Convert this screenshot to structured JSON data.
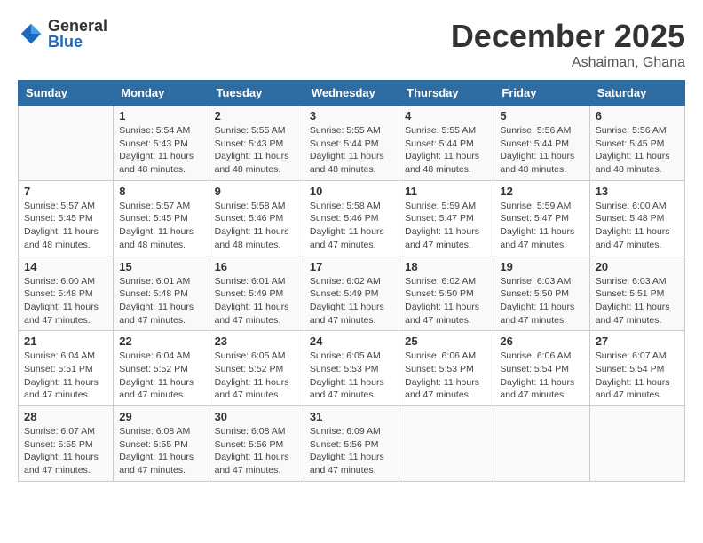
{
  "logo": {
    "general": "General",
    "blue": "Blue"
  },
  "title": "December 2025",
  "location": "Ashaiman, Ghana",
  "days_of_week": [
    "Sunday",
    "Monday",
    "Tuesday",
    "Wednesday",
    "Thursday",
    "Friday",
    "Saturday"
  ],
  "weeks": [
    [
      {
        "day": "",
        "info": ""
      },
      {
        "day": "1",
        "info": "Sunrise: 5:54 AM\nSunset: 5:43 PM\nDaylight: 11 hours\nand 48 minutes."
      },
      {
        "day": "2",
        "info": "Sunrise: 5:55 AM\nSunset: 5:43 PM\nDaylight: 11 hours\nand 48 minutes."
      },
      {
        "day": "3",
        "info": "Sunrise: 5:55 AM\nSunset: 5:44 PM\nDaylight: 11 hours\nand 48 minutes."
      },
      {
        "day": "4",
        "info": "Sunrise: 5:55 AM\nSunset: 5:44 PM\nDaylight: 11 hours\nand 48 minutes."
      },
      {
        "day": "5",
        "info": "Sunrise: 5:56 AM\nSunset: 5:44 PM\nDaylight: 11 hours\nand 48 minutes."
      },
      {
        "day": "6",
        "info": "Sunrise: 5:56 AM\nSunset: 5:45 PM\nDaylight: 11 hours\nand 48 minutes."
      }
    ],
    [
      {
        "day": "7",
        "info": "Sunrise: 5:57 AM\nSunset: 5:45 PM\nDaylight: 11 hours\nand 48 minutes."
      },
      {
        "day": "8",
        "info": "Sunrise: 5:57 AM\nSunset: 5:45 PM\nDaylight: 11 hours\nand 48 minutes."
      },
      {
        "day": "9",
        "info": "Sunrise: 5:58 AM\nSunset: 5:46 PM\nDaylight: 11 hours\nand 48 minutes."
      },
      {
        "day": "10",
        "info": "Sunrise: 5:58 AM\nSunset: 5:46 PM\nDaylight: 11 hours\nand 47 minutes."
      },
      {
        "day": "11",
        "info": "Sunrise: 5:59 AM\nSunset: 5:47 PM\nDaylight: 11 hours\nand 47 minutes."
      },
      {
        "day": "12",
        "info": "Sunrise: 5:59 AM\nSunset: 5:47 PM\nDaylight: 11 hours\nand 47 minutes."
      },
      {
        "day": "13",
        "info": "Sunrise: 6:00 AM\nSunset: 5:48 PM\nDaylight: 11 hours\nand 47 minutes."
      }
    ],
    [
      {
        "day": "14",
        "info": "Sunrise: 6:00 AM\nSunset: 5:48 PM\nDaylight: 11 hours\nand 47 minutes."
      },
      {
        "day": "15",
        "info": "Sunrise: 6:01 AM\nSunset: 5:48 PM\nDaylight: 11 hours\nand 47 minutes."
      },
      {
        "day": "16",
        "info": "Sunrise: 6:01 AM\nSunset: 5:49 PM\nDaylight: 11 hours\nand 47 minutes."
      },
      {
        "day": "17",
        "info": "Sunrise: 6:02 AM\nSunset: 5:49 PM\nDaylight: 11 hours\nand 47 minutes."
      },
      {
        "day": "18",
        "info": "Sunrise: 6:02 AM\nSunset: 5:50 PM\nDaylight: 11 hours\nand 47 minutes."
      },
      {
        "day": "19",
        "info": "Sunrise: 6:03 AM\nSunset: 5:50 PM\nDaylight: 11 hours\nand 47 minutes."
      },
      {
        "day": "20",
        "info": "Sunrise: 6:03 AM\nSunset: 5:51 PM\nDaylight: 11 hours\nand 47 minutes."
      }
    ],
    [
      {
        "day": "21",
        "info": "Sunrise: 6:04 AM\nSunset: 5:51 PM\nDaylight: 11 hours\nand 47 minutes."
      },
      {
        "day": "22",
        "info": "Sunrise: 6:04 AM\nSunset: 5:52 PM\nDaylight: 11 hours\nand 47 minutes."
      },
      {
        "day": "23",
        "info": "Sunrise: 6:05 AM\nSunset: 5:52 PM\nDaylight: 11 hours\nand 47 minutes."
      },
      {
        "day": "24",
        "info": "Sunrise: 6:05 AM\nSunset: 5:53 PM\nDaylight: 11 hours\nand 47 minutes."
      },
      {
        "day": "25",
        "info": "Sunrise: 6:06 AM\nSunset: 5:53 PM\nDaylight: 11 hours\nand 47 minutes."
      },
      {
        "day": "26",
        "info": "Sunrise: 6:06 AM\nSunset: 5:54 PM\nDaylight: 11 hours\nand 47 minutes."
      },
      {
        "day": "27",
        "info": "Sunrise: 6:07 AM\nSunset: 5:54 PM\nDaylight: 11 hours\nand 47 minutes."
      }
    ],
    [
      {
        "day": "28",
        "info": "Sunrise: 6:07 AM\nSunset: 5:55 PM\nDaylight: 11 hours\nand 47 minutes."
      },
      {
        "day": "29",
        "info": "Sunrise: 6:08 AM\nSunset: 5:55 PM\nDaylight: 11 hours\nand 47 minutes."
      },
      {
        "day": "30",
        "info": "Sunrise: 6:08 AM\nSunset: 5:56 PM\nDaylight: 11 hours\nand 47 minutes."
      },
      {
        "day": "31",
        "info": "Sunrise: 6:09 AM\nSunset: 5:56 PM\nDaylight: 11 hours\nand 47 minutes."
      },
      {
        "day": "",
        "info": ""
      },
      {
        "day": "",
        "info": ""
      },
      {
        "day": "",
        "info": ""
      }
    ]
  ]
}
